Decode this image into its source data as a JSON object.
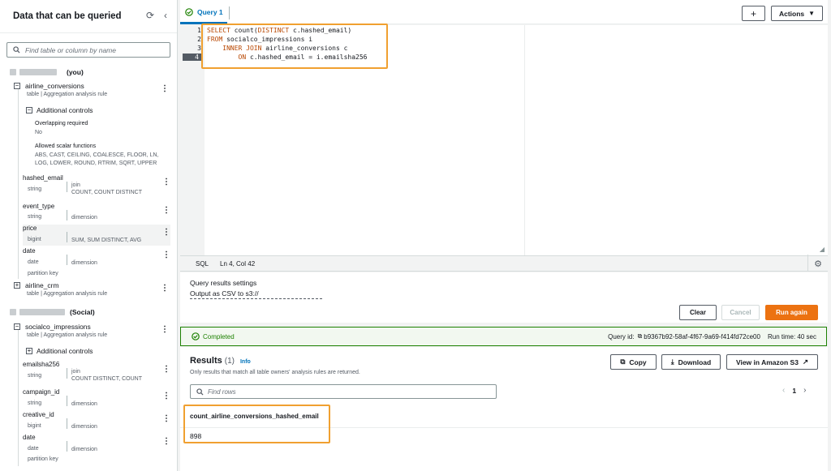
{
  "sidebar": {
    "title": "Data that can be queried",
    "search_placeholder": "Find table or column by name",
    "groups": [
      {
        "owner_suffix": "(you)",
        "table": {
          "name": "airline_conversions",
          "subtitle": "table | Aggregation analysis rule",
          "additional_controls": "Additional controls",
          "controls": [
            {
              "label": "Overlapping required",
              "value": "No"
            },
            {
              "label": "Allowed scalar functions",
              "value": "ABS, CAST, CEILING, COALESCE, FLOOR, LN, LOG, LOWER, ROUND, RTRIM, SQRT, UPPER"
            }
          ],
          "columns": [
            {
              "name": "hashed_email",
              "type": "string",
              "role": "join",
              "rule": "COUNT, COUNT DISTINCT"
            },
            {
              "name": "event_type",
              "type": "string",
              "role": "dimension"
            },
            {
              "name": "price",
              "type": "bigint",
              "role": "SUM, SUM DISTINCT, AVG"
            },
            {
              "name": "date",
              "type": "date",
              "role": "dimension",
              "extra": "partition key"
            }
          ]
        },
        "table2": {
          "name": "airline_crm",
          "subtitle": "table | Aggregation analysis rule"
        }
      },
      {
        "owner_suffix": "(Social)",
        "table": {
          "name": "socialco_impressions",
          "subtitle": "table | Aggregation analysis rule",
          "additional_controls": "Additional controls",
          "columns": [
            {
              "name": "emailsha256",
              "type": "string",
              "role": "join",
              "rule": "COUNT DISTINCT, COUNT"
            },
            {
              "name": "campaign_id",
              "type": "string",
              "role": "dimension"
            },
            {
              "name": "creative_id",
              "type": "bigint",
              "role": "dimension"
            },
            {
              "name": "date",
              "type": "date",
              "role": "dimension",
              "extra": "partition key"
            }
          ]
        }
      }
    ]
  },
  "tab": {
    "label": "Query 1"
  },
  "toolbar": {
    "add": "+",
    "actions": "Actions"
  },
  "editor": {
    "line_numbers": [
      "1",
      "2",
      "3",
      "4"
    ],
    "status_lang": "SQL",
    "status_pos": "Ln 4, Col 42"
  },
  "settings": {
    "title": "Query results settings",
    "output": "Output as CSV to s3://",
    "clear": "Clear",
    "cancel": "Cancel",
    "run_again": "Run again"
  },
  "status": {
    "completed": "Completed",
    "query_id_label": "Query id:",
    "query_id": "b9367b92-58af-4f67-9a69-f414fd72ce00",
    "run_time": "Run time: 40 sec"
  },
  "results": {
    "title": "Results",
    "count": "(1)",
    "info": "Info",
    "note": "Only results that match all table owners' analysis rules are returned.",
    "copy": "Copy",
    "download": "Download",
    "view_s3": "View in Amazon S3",
    "find_placeholder": "Find rows",
    "page": "1",
    "column": "count_airline_conversions_hashed_email",
    "value": "898"
  },
  "colors": {
    "accent": "#0073bb",
    "primary": "#ec7211",
    "highlight": "#f0a030",
    "success": "#1d8102"
  }
}
